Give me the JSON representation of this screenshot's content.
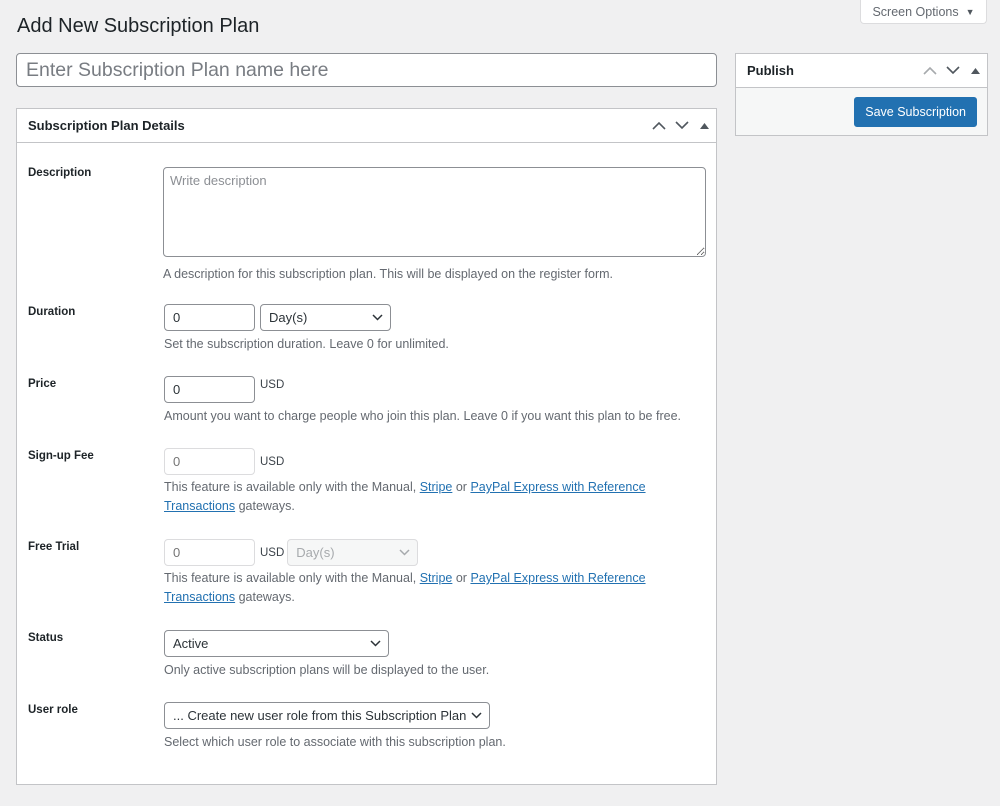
{
  "screen_options": {
    "label": "Screen Options"
  },
  "page": {
    "title": "Add New Subscription Plan",
    "name_placeholder": "Enter Subscription Plan name here"
  },
  "details_box": {
    "title": "Subscription Plan Details",
    "fields": {
      "description": {
        "label": "Description",
        "placeholder": "Write description",
        "value": "",
        "help": "A description for this subscription plan. This will be displayed on the register form."
      },
      "duration": {
        "label": "Duration",
        "value": "0",
        "unit": "Day(s)",
        "help": "Set the subscription duration. Leave 0 for unlimited."
      },
      "price": {
        "label": "Price",
        "value": "0",
        "currency": "USD",
        "help": "Amount you want to charge people who join this plan. Leave 0 if you want this plan to be free."
      },
      "signup_fee": {
        "label": "Sign-up Fee",
        "placeholder": "0",
        "currency": "USD",
        "help_prefix": "This feature is available only with the Manual,",
        "link_stripe": "Stripe",
        "help_or": "or",
        "link_paypal": "PayPal Express with Reference Transactions",
        "help_suffix": "gateways."
      },
      "free_trial": {
        "label": "Free Trial",
        "placeholder": "0",
        "currency": "USD",
        "unit": "Day(s)",
        "help_prefix": "This feature is available only with the Manual,",
        "link_stripe": "Stripe",
        "help_or": "or",
        "link_paypal": "PayPal Express with Reference Transactions",
        "help_suffix": "gateways."
      },
      "status": {
        "label": "Status",
        "value": "Active",
        "help": "Only active subscription plans will be displayed to the user."
      },
      "user_role": {
        "label": "User role",
        "value": "... Create new user role from this Subscription Plan",
        "help": "Select which user role to associate with this subscription plan."
      }
    }
  },
  "publish_box": {
    "title": "Publish",
    "save_label": "Save Subscription"
  },
  "colors": {
    "primary": "#2271b1",
    "background": "#f0f0f1"
  }
}
